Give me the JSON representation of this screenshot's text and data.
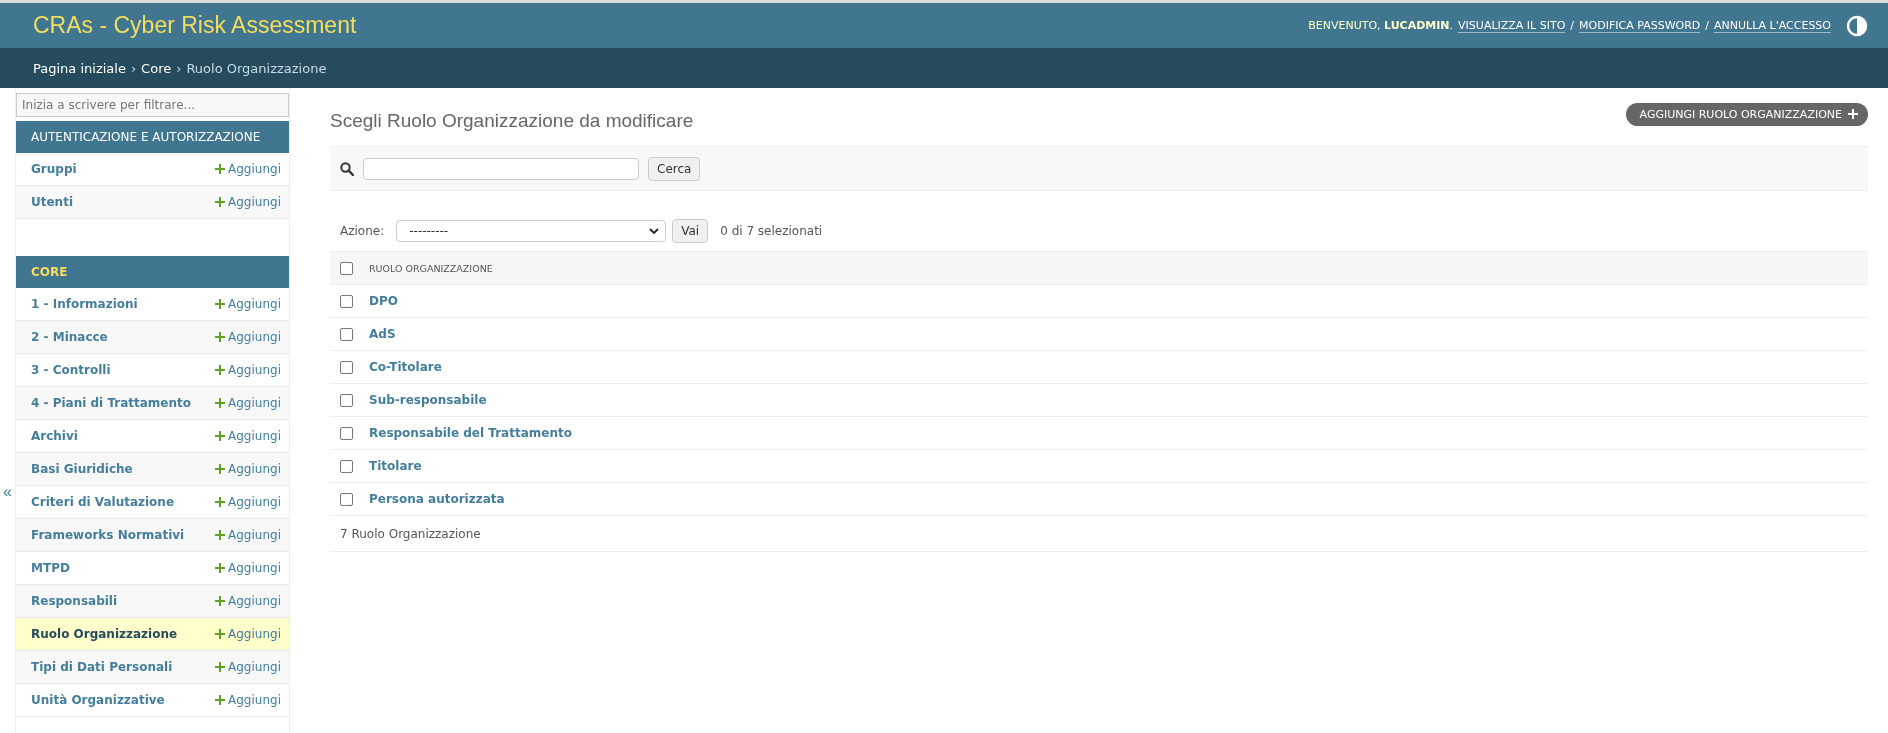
{
  "header": {
    "title": "CRAs - Cyber Risk Assessment",
    "welcome": "BENVENUTO, **LUCADMIN**.",
    "links": [
      "VISUALIZZA IL SITO",
      "MODIFICA PASSWORD",
      "ANNULLA L'ACCESSO"
    ],
    "separator": "/"
  },
  "breadcrumbs": [
    {
      "label": "Pagina iniziale",
      "current": false
    },
    {
      "label": "Core",
      "current": false
    },
    {
      "label": "Ruolo Organizzazione",
      "current": true
    }
  ],
  "breadcrumb_separator": "›",
  "sidebar": {
    "filter_placeholder": "Inizia a scrivere per filtrare...",
    "toggle": "«",
    "sections": [
      {
        "title": "AUTENTICAZIONE E AUTORIZZAZIONE",
        "items": [
          {
            "label": "Gruppi",
            "add": "Aggiungi",
            "selected": false
          },
          {
            "label": "Utenti",
            "add": "Aggiungi",
            "selected": false
          }
        ]
      },
      {
        "title": "CORE",
        "items": [
          {
            "label": "1 - Informazioni",
            "add": "Aggiungi",
            "selected": false
          },
          {
            "label": "2 - Minacce",
            "add": "Aggiungi",
            "selected": false
          },
          {
            "label": "3 - Controlli",
            "add": "Aggiungi",
            "selected": false
          },
          {
            "label": "4 - Piani di Trattamento",
            "add": "Aggiungi",
            "selected": false
          },
          {
            "label": "Archivi",
            "add": "Aggiungi",
            "selected": false
          },
          {
            "label": "Basi Giuridiche",
            "add": "Aggiungi",
            "selected": false
          },
          {
            "label": "Criteri di Valutazione",
            "add": "Aggiungi",
            "selected": false
          },
          {
            "label": "Frameworks Normativi",
            "add": "Aggiungi",
            "selected": false
          },
          {
            "label": "MTPD",
            "add": "Aggiungi",
            "selected": false
          },
          {
            "label": "Responsabili",
            "add": "Aggiungi",
            "selected": false
          },
          {
            "label": "Ruolo Organizzazione",
            "add": "Aggiungi",
            "selected": true
          },
          {
            "label": "Tipi di Dati Personali",
            "add": "Aggiungi",
            "selected": false
          },
          {
            "label": "Unità Organizzative",
            "add": "Aggiungi",
            "selected": false
          }
        ]
      }
    ]
  },
  "main": {
    "title": "Scegli Ruolo Organizzazione da modificare",
    "add_button": "AGGIUNGI RUOLO ORGANIZZAZIONE",
    "search_button": "Cerca",
    "action_label": "Azione:",
    "action_value": "---------",
    "go_button": "Vai",
    "selection_count": "0 di 7 selezionati",
    "table": {
      "column": "RUOLO ORGANIZZAZIONE",
      "header_checked": false,
      "rows": [
        {
          "name": "DPO",
          "checked": false
        },
        {
          "name": "AdS",
          "checked": false
        },
        {
          "name": "Co-Titolare",
          "checked": false
        },
        {
          "name": "Sub-responsabile",
          "checked": false
        },
        {
          "name": "Responsabile del Trattamento",
          "checked": false
        },
        {
          "name": "Titolare",
          "checked": false
        },
        {
          "name": "Persona autorizzata",
          "checked": false
        }
      ]
    },
    "footer": "7 Ruolo Organizzazione"
  }
}
